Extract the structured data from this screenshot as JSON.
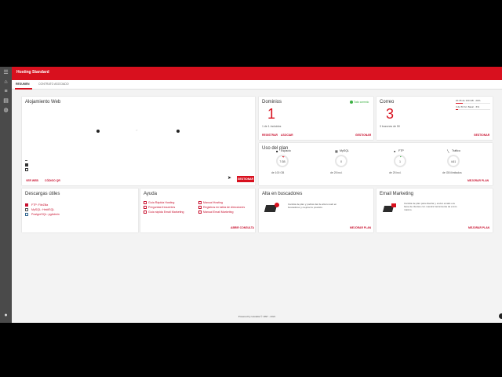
{
  "app": {
    "title": "Hosting Standard"
  },
  "tabs": [
    {
      "label": "RESUMEN"
    },
    {
      "label": "CONTRATO ASOCIADO"
    }
  ],
  "hosting": {
    "title": "Alojamiento Web",
    "link_web": "VER WEB",
    "link_qr": "CÓDIGO QR",
    "manage_button": "GESTIONAR"
  },
  "dominios": {
    "title": "Dominios",
    "count": "1",
    "status": "Todo correcto",
    "sub": "1 de 1 incluidos",
    "link_register": "REGISTRAR",
    "link_associate": "ASOCIAR",
    "link_manage": "GESTIONAR"
  },
  "correo": {
    "title": "Correo",
    "count": "3",
    "sub": "3 buzones de 50",
    "quota_line1": "20.35 de 100 GB · 20%",
    "quota_line1_fill": 0.2,
    "quota_line2": "3 de 50 bz. Basic · 6%",
    "quota_line2_fill": 0.06,
    "link_manage": "GESTIONAR"
  },
  "uso": {
    "title": "Uso del plan",
    "items": [
      {
        "label": "Espacio",
        "value": "7 GB",
        "sub": "de 100 GB",
        "fill": 0.07,
        "icon": "folder-icon"
      },
      {
        "label": "MySQL",
        "value": "0",
        "sub": "de 25 incl.",
        "fill": 0.0,
        "icon": "database-icon"
      },
      {
        "label": "FTP",
        "value": "1",
        "sub": "de 25 incl.",
        "fill": 0.04,
        "icon": "user-icon"
      },
      {
        "label": "Tráfico",
        "value": "4.61",
        "sub": "de GB ilimitados",
        "fill": 0.0,
        "icon": "chart-icon"
      }
    ],
    "link_upgrade": "MEJORAR PLAN"
  },
  "descargas": {
    "title": "Descargas útiles",
    "items": [
      "FTP: FileZilla",
      "MySQL: HeidiSQL",
      "PostgreSQL: pgAdmin"
    ]
  },
  "ayuda": {
    "title": "Ayuda",
    "col1": [
      "Guía Rápida Hosting",
      "Preguntas frecuentes",
      "Guía rápida Email Marketing"
    ],
    "col2": [
      "Manual Hosting",
      "Registros en tabla de direcciones",
      "Manual Email Marketing"
    ],
    "link_open": "ABRIR CONSULTA"
  },
  "buscadores": {
    "title": "Alta en buscadores",
    "desc": "Cambia de plan y podrás dar de alta tu web en buscadores y mejorar tu posición.",
    "link_upgrade": "MEJORAR PLAN"
  },
  "email_marketing": {
    "title": "Email Marketing",
    "desc": "Cambia de plan para diseñar y enviar emails a tu base de clientes con nuestra herramienta de envío masivo.",
    "link_upgrade": "MEJORAR PLAN"
  },
  "footer": {
    "text": "Powered by Hostalia © 1997 - 2021"
  },
  "colors": {
    "brand": "#d8101e",
    "rail": "#4a4a4a",
    "ok": "#3cb043"
  }
}
